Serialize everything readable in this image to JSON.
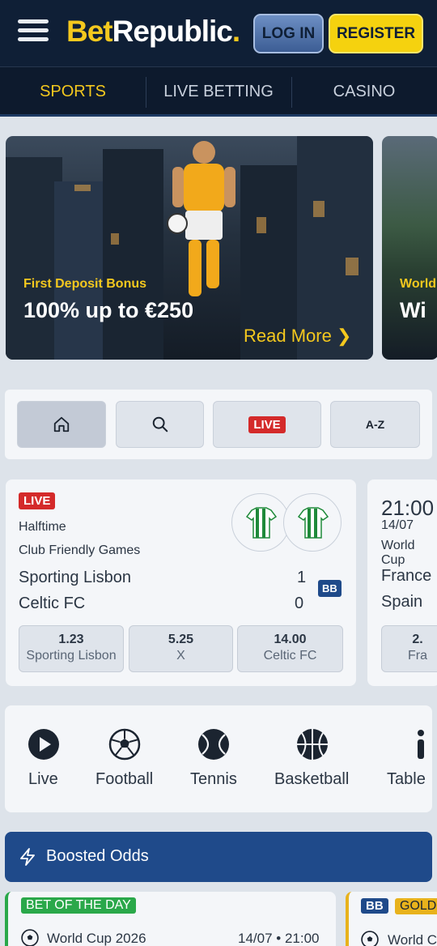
{
  "header": {
    "logo_bet": "Bet",
    "logo_republic": "Republic",
    "logo_dot": ".",
    "login_label": "LOG IN",
    "register_label": "REGISTER"
  },
  "nav": {
    "items": [
      {
        "label": "SPORTS",
        "active": true
      },
      {
        "label": "LIVE BETTING",
        "active": false
      },
      {
        "label": "CASINO",
        "active": false
      }
    ]
  },
  "banners": [
    {
      "subtitle": "First Deposit Bonus",
      "title": "100% up to €250",
      "cta": "Read More"
    },
    {
      "subtitle": "World",
      "title": "Wi"
    }
  ],
  "quick_tabs": {
    "live_label": "LIVE",
    "az_label": "A-Z",
    "icons": [
      "home-icon",
      "search-icon"
    ]
  },
  "matches": [
    {
      "live_badge": "LIVE",
      "status": "Halftime",
      "competition": "Club Friendly Games",
      "home": "Sporting Lisbon",
      "away": "Celtic FC",
      "home_score": "1",
      "away_score": "0",
      "bb_badge": "BB",
      "odds": [
        {
          "value": "1.23",
          "label": "Sporting Lisbon"
        },
        {
          "value": "5.25",
          "label": "X"
        },
        {
          "value": "14.00",
          "label": "Celtic FC"
        }
      ]
    },
    {
      "time": "21:00",
      "date": "14/07",
      "competition": "World Cup",
      "home": "France",
      "away": "Spain",
      "odds": [
        {
          "value": "2.",
          "label": "Fra"
        }
      ]
    }
  ],
  "sports": [
    {
      "label": "Live",
      "icon": "play-icon"
    },
    {
      "label": "Football",
      "icon": "football-icon"
    },
    {
      "label": "Tennis",
      "icon": "tennis-icon"
    },
    {
      "label": "Basketball",
      "icon": "basketball-icon"
    },
    {
      "label": "Table",
      "icon": "table-tennis-icon"
    }
  ],
  "boosted": {
    "label": "Boosted Odds"
  },
  "bottom_cards": [
    {
      "tag": "BET OF THE DAY",
      "competition": "World Cup 2026",
      "datetime": "14/07 • 21:00"
    },
    {
      "bb": "BB",
      "tag": "GOLD",
      "competition": "World C"
    }
  ],
  "colors": {
    "brand_yellow": "#f4c81e",
    "header_bg": "#0f1f36",
    "live_red": "#d42a2a",
    "accent_blue": "#1f4a8a"
  }
}
